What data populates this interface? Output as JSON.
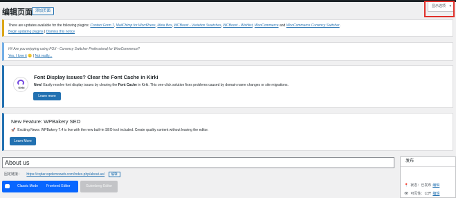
{
  "header": {
    "page_title": "编辑页面",
    "add_new": "添加页面",
    "screen_options": "显示选项",
    "screen_options_caret": "▾"
  },
  "notices": {
    "update": {
      "prefix": "There are updates available for the following plugins:",
      "plugins": [
        "Contact Form 7",
        "MailChimp for WordPress",
        "Meta Box",
        "WCBoost - Variation Swatches",
        "WCBoost - Wishlist",
        "WooCommerce"
      ],
      "and": "and",
      "last_plugin": "WooCommerce Currency Switcher",
      "begin_link": "Begin updating plugins",
      "separator": "|",
      "dismiss_link": "Dismiss this notice"
    },
    "fox": {
      "question": "Hi! Are you enjoying using FOX - Currency Switcher Professional for WooCommerce?",
      "yes": "Yes, I love it",
      "emoji": "🙂",
      "separator": "|",
      "not_really": "Not really..."
    },
    "kirki": {
      "logo_text": "Kirki",
      "title": "Font Display Issues? Clear the Font Cache in Kirki",
      "desc_new": "New!",
      "desc_body": "Easily resolve font display issues by clearing the",
      "desc_bold": "Font Cache",
      "desc_rest": "in Kirki. This one-click solution fixes problems caused by domain name changes or site migrations.",
      "button": "Learn more"
    },
    "wpbakery": {
      "title": "New Feature: WPBakery SEO",
      "rocket": "🚀",
      "desc": "Exciting News: WPBakery 7.4 is live with the new built-in SEO tool included. Create quality content without leaving the editor.",
      "button": "Learn More"
    }
  },
  "editor": {
    "title_value": "About us",
    "permalink_label": "固定链接：",
    "permalink_url": "https://cqbar.wpdemoweb.com/index.php/about-us/",
    "permalink_edit": "编辑",
    "classic_mode": "Classic Mode",
    "frontend_editor": "Frontend Editor",
    "gutenberg_editor": "Gutenberg Editor"
  },
  "publish_box": {
    "header": "发布",
    "status_label": "状态：",
    "status_value": "已发布",
    "status_edit": "编辑",
    "visibility_label": "可见性：",
    "visibility_value": "公开",
    "visibility_edit": "编辑"
  },
  "colors": {
    "accent": "#2271b1",
    "warning": "#dba617",
    "highlight_box": "#e0302a",
    "wpbakery": "#0866ff"
  }
}
